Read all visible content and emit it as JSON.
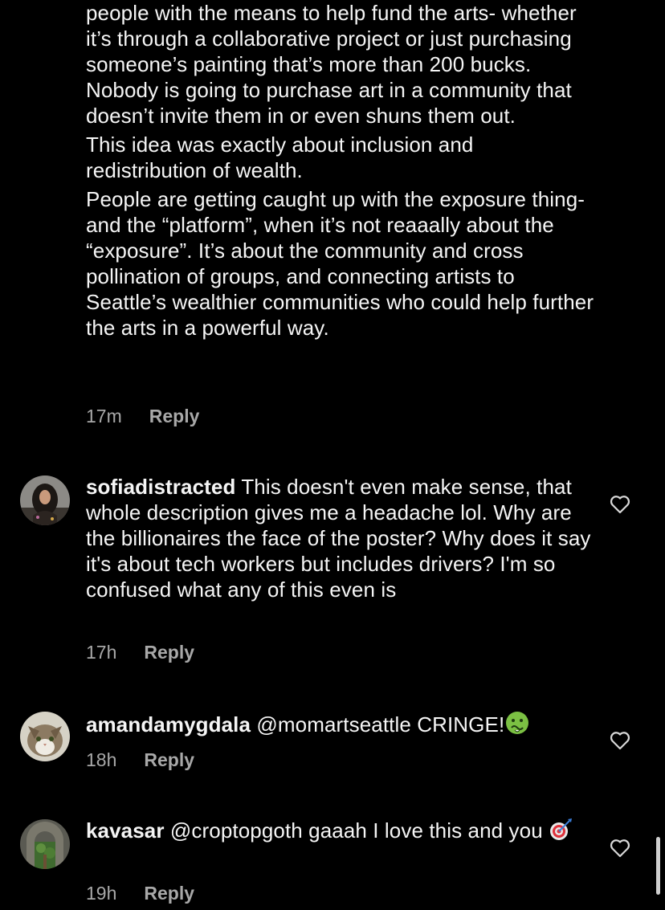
{
  "comments": [
    {
      "paragraphs": [
        "people with the means to help fund the arts- whether it’s through a collaborative project or just purchasing someone’s painting that’s more than 200 bucks. Nobody is going to purchase art in a community that doesn’t invite them in or even shuns them out.",
        "This idea was exactly about inclusion and redistribution of wealth.",
        "People are getting caught up with the exposure thing- and the “platform”, when it’s not reaaally about the “exposure”. It’s about the community and cross pollination of groups, and connecting artists to Seattle’s wealthier communities who could help further the arts in a powerful way."
      ],
      "time": "17m",
      "reply": "Reply"
    },
    {
      "username": "sofiadistracted",
      "text": "This doesn't even make sense, that whole description gives me a headache lol. Why are the billionaires the face of the poster? Why does it say it's about tech workers but includes drivers? I'm so confused what any of this even is",
      "time": "17h",
      "reply": "Reply",
      "avatar": "avatar-woman-dark-hair",
      "like_icon": "heart-outline-icon"
    },
    {
      "username": "amandamygdala",
      "mention": "@momartseattle",
      "text": "CRINGE!",
      "emoji": "nauseated-face-emoji",
      "time": "18h",
      "reply": "Reply",
      "avatar": "avatar-cat",
      "like_icon": "heart-outline-icon"
    },
    {
      "username": "kavasar",
      "mention": "@croptopgoth",
      "text": "gaaah I love this and you",
      "emoji": "direct-hit-emoji",
      "time": "19h",
      "reply": "Reply",
      "avatar": "avatar-stone-arch-garden",
      "like_icon": "heart-outline-icon"
    }
  ],
  "colors": {
    "background": "#000000",
    "text": "#f5f5f5",
    "secondary": "#a8a8a8",
    "emoji_green": "#7bc043"
  }
}
